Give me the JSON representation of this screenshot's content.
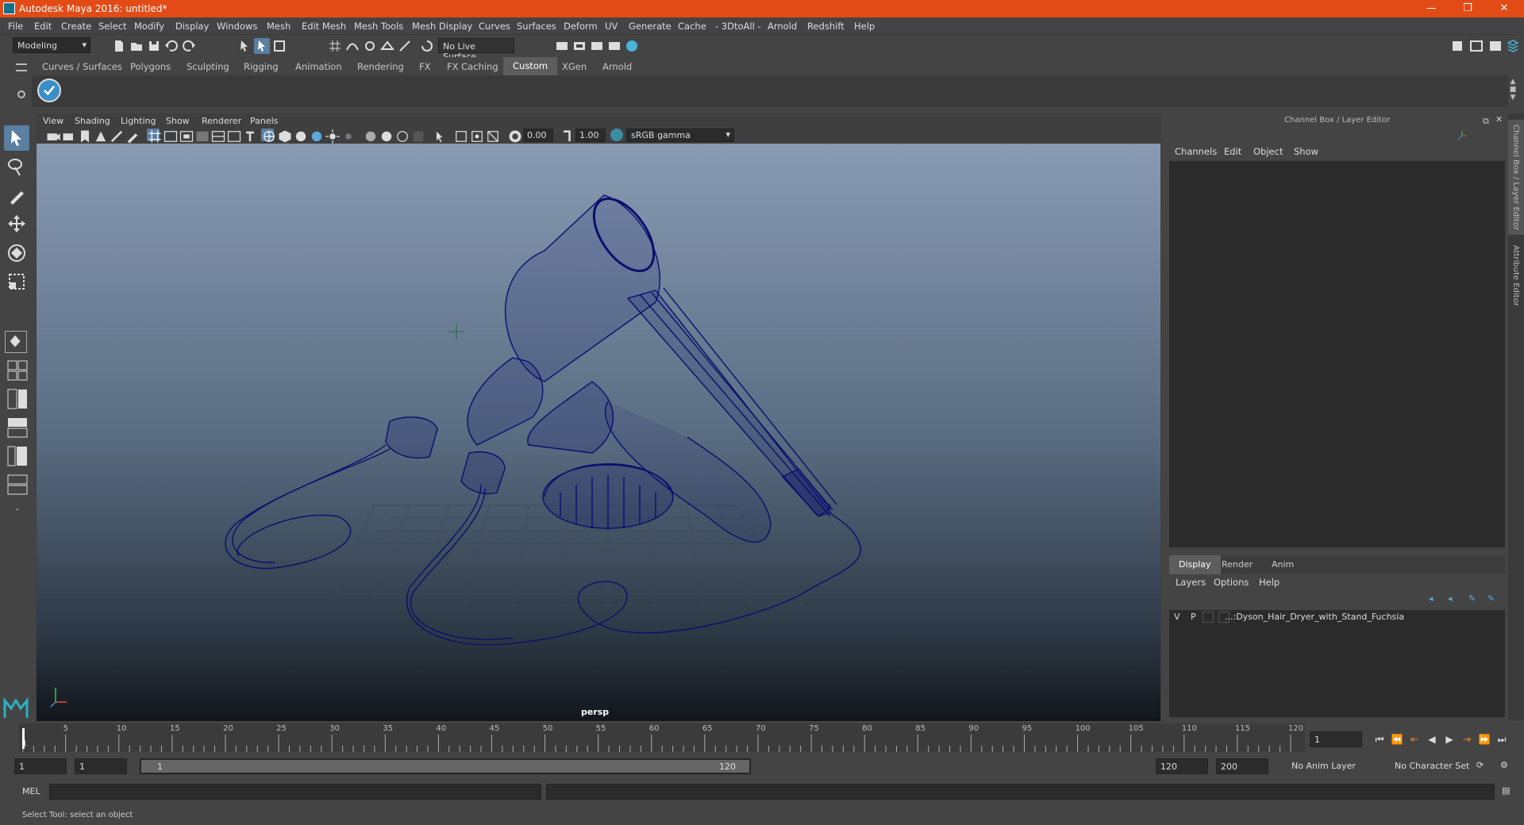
{
  "window": {
    "title": "Autodesk Maya 2016: untitled*",
    "minimize": "—",
    "maximize": "❐",
    "close": "✕"
  },
  "menubar": [
    "File",
    "Edit",
    "Create",
    "Select",
    "Modify",
    "Display",
    "Windows",
    "Mesh",
    "Edit Mesh",
    "Mesh Tools",
    "Mesh Display",
    "Curves",
    "Surfaces",
    "Deform",
    "UV",
    "Generate",
    "Cache",
    "- 3DtoAll -",
    "Arnold",
    "Redshift",
    "Help"
  ],
  "status": {
    "mode": "Modeling",
    "live_surface": "No Live Surface"
  },
  "shelf_tabs": [
    "Curves / Surfaces",
    "Polygons",
    "Sculpting",
    "Rigging",
    "Animation",
    "Rendering",
    "FX",
    "FX Caching",
    "Custom",
    "XGen",
    "Arnold"
  ],
  "shelf_active": "Custom",
  "viewport": {
    "menu": [
      "View",
      "Shading",
      "Lighting",
      "Show",
      "Renderer",
      "Panels"
    ],
    "exposure": "0.00",
    "gamma": "1.00",
    "colorspace": "sRGB gamma",
    "camera": "persp",
    "wireframe_color": "#0a0e6e"
  },
  "channel_box": {
    "title": "Channel Box / Layer Editor",
    "menu": [
      "Channels",
      "Edit",
      "Object",
      "Show"
    ],
    "layer_tabs": [
      "Display",
      "Render",
      "Anim"
    ],
    "active_layer_tab": "Display",
    "layer_menu": [
      "Layers",
      "Options",
      "Help"
    ],
    "layer": {
      "v": "V",
      "p": "P",
      "name": "...:Dyson_Hair_Dryer_with_Stand_Fuchsia"
    }
  },
  "side_tabs": [
    "Channel Box / Layer Editor",
    "Attribute Editor"
  ],
  "timeline": {
    "ticks": [
      "5",
      "10",
      "15",
      "20",
      "25",
      "30",
      "35",
      "40",
      "45",
      "50",
      "55",
      "60",
      "65",
      "70",
      "75",
      "80",
      "85",
      "90",
      "95",
      "100",
      "105",
      "110",
      "115",
      "120"
    ],
    "start_marker": "1",
    "current_frame": "1"
  },
  "range": {
    "start": "1",
    "anim_start": "1",
    "slider_start": "1",
    "slider_end": "120",
    "end": "120",
    "anim_end": "200",
    "anim_layer": "No Anim Layer",
    "char_set": "No Character Set"
  },
  "cmd": {
    "label": "MEL"
  },
  "help_line": "Select Tool: select an object",
  "colors": {
    "titlebar": "#e34b16",
    "accent": "#5d5d5d"
  }
}
